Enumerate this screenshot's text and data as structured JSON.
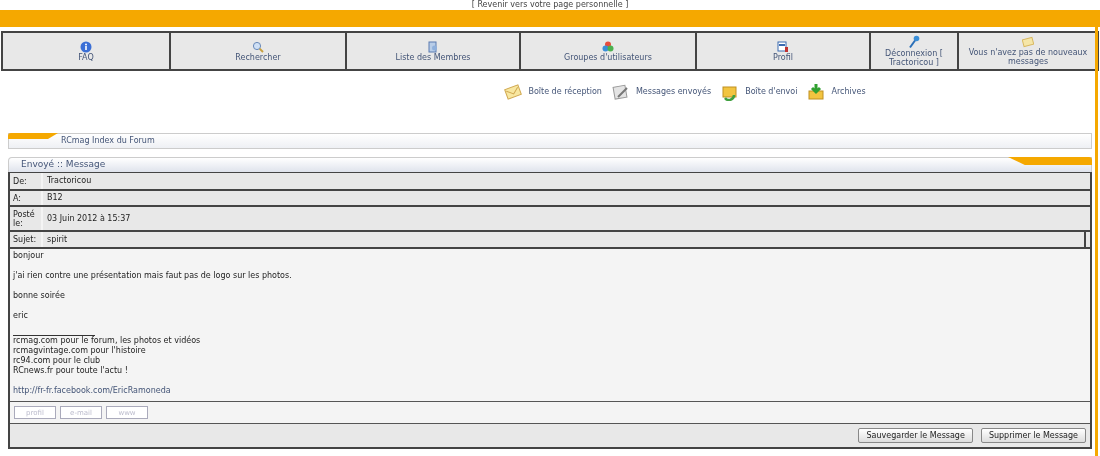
{
  "top_link": "[ Revenir vers votre page personnelle ]",
  "nav": [
    {
      "label": "FAQ"
    },
    {
      "label": "Rechercher"
    },
    {
      "label": "Liste des Membres"
    },
    {
      "label": "Groupes d'utilisateurs"
    },
    {
      "label": "Profil"
    },
    {
      "label": "Déconnexion [ Tractoricou ]"
    },
    {
      "label": "Vous n'avez pas de nouveaux messages"
    }
  ],
  "mailboxes": [
    {
      "label": "Boîte de réception"
    },
    {
      "label": "Messages envoyés"
    },
    {
      "label": "Boîte d'envoi"
    },
    {
      "label": "Archives"
    }
  ],
  "breadcrumb": "RCmag Index du Forum",
  "panel_title": "Envoyé :: Message",
  "fields": [
    {
      "label": "De:",
      "value": "Tractoricou"
    },
    {
      "label": "A:",
      "value": "B12"
    },
    {
      "label": "Posté le:",
      "value": "03 Juin 2012 à 15:37"
    },
    {
      "label": "Sujet:",
      "value": "spirit"
    }
  ],
  "body": [
    "bonjour",
    "j'ai rien contre une présentation mais faut pas de logo sur les photos.",
    "bonne soirée",
    "eric"
  ],
  "signature": [
    "rcmag.com pour le forum, les photos et vidéos",
    "rcmagvintage.com pour l'histoire",
    "rc94.com pour le club",
    "RCnews.fr pour toute l'actu !"
  ],
  "signature_link": "http://fr-fr.facebook.com/EricRamoneda",
  "profile_buttons": [
    "profil",
    "e-mail",
    "www"
  ],
  "actions": [
    "Sauvegarder le Message",
    "Supprimer le Message"
  ]
}
